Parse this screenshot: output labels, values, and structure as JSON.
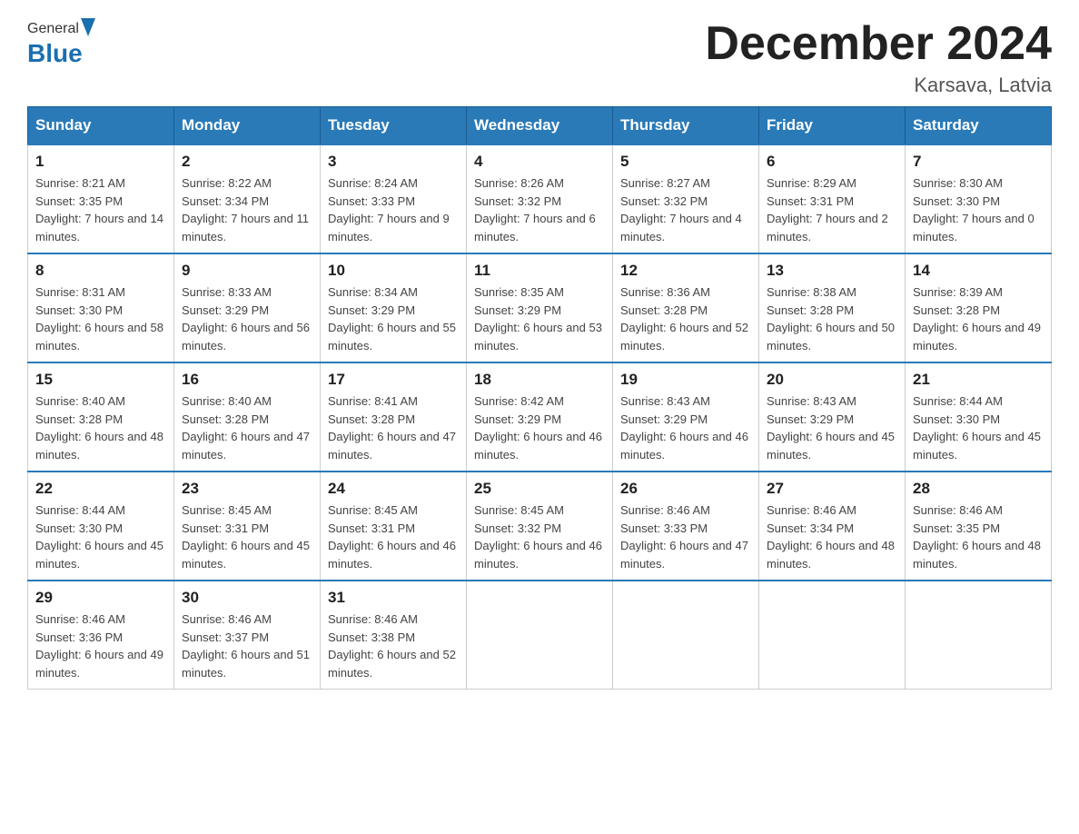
{
  "header": {
    "logo_general": "General",
    "logo_blue": "Blue",
    "month_title": "December 2024",
    "location": "Karsava, Latvia"
  },
  "weekdays": [
    "Sunday",
    "Monday",
    "Tuesday",
    "Wednesday",
    "Thursday",
    "Friday",
    "Saturday"
  ],
  "weeks": [
    [
      {
        "day": "1",
        "sunrise": "8:21 AM",
        "sunset": "3:35 PM",
        "daylight": "7 hours and 14 minutes."
      },
      {
        "day": "2",
        "sunrise": "8:22 AM",
        "sunset": "3:34 PM",
        "daylight": "7 hours and 11 minutes."
      },
      {
        "day": "3",
        "sunrise": "8:24 AM",
        "sunset": "3:33 PM",
        "daylight": "7 hours and 9 minutes."
      },
      {
        "day": "4",
        "sunrise": "8:26 AM",
        "sunset": "3:32 PM",
        "daylight": "7 hours and 6 minutes."
      },
      {
        "day": "5",
        "sunrise": "8:27 AM",
        "sunset": "3:32 PM",
        "daylight": "7 hours and 4 minutes."
      },
      {
        "day": "6",
        "sunrise": "8:29 AM",
        "sunset": "3:31 PM",
        "daylight": "7 hours and 2 minutes."
      },
      {
        "day": "7",
        "sunrise": "8:30 AM",
        "sunset": "3:30 PM",
        "daylight": "7 hours and 0 minutes."
      }
    ],
    [
      {
        "day": "8",
        "sunrise": "8:31 AM",
        "sunset": "3:30 PM",
        "daylight": "6 hours and 58 minutes."
      },
      {
        "day": "9",
        "sunrise": "8:33 AM",
        "sunset": "3:29 PM",
        "daylight": "6 hours and 56 minutes."
      },
      {
        "day": "10",
        "sunrise": "8:34 AM",
        "sunset": "3:29 PM",
        "daylight": "6 hours and 55 minutes."
      },
      {
        "day": "11",
        "sunrise": "8:35 AM",
        "sunset": "3:29 PM",
        "daylight": "6 hours and 53 minutes."
      },
      {
        "day": "12",
        "sunrise": "8:36 AM",
        "sunset": "3:28 PM",
        "daylight": "6 hours and 52 minutes."
      },
      {
        "day": "13",
        "sunrise": "8:38 AM",
        "sunset": "3:28 PM",
        "daylight": "6 hours and 50 minutes."
      },
      {
        "day": "14",
        "sunrise": "8:39 AM",
        "sunset": "3:28 PM",
        "daylight": "6 hours and 49 minutes."
      }
    ],
    [
      {
        "day": "15",
        "sunrise": "8:40 AM",
        "sunset": "3:28 PM",
        "daylight": "6 hours and 48 minutes."
      },
      {
        "day": "16",
        "sunrise": "8:40 AM",
        "sunset": "3:28 PM",
        "daylight": "6 hours and 47 minutes."
      },
      {
        "day": "17",
        "sunrise": "8:41 AM",
        "sunset": "3:28 PM",
        "daylight": "6 hours and 47 minutes."
      },
      {
        "day": "18",
        "sunrise": "8:42 AM",
        "sunset": "3:29 PM",
        "daylight": "6 hours and 46 minutes."
      },
      {
        "day": "19",
        "sunrise": "8:43 AM",
        "sunset": "3:29 PM",
        "daylight": "6 hours and 46 minutes."
      },
      {
        "day": "20",
        "sunrise": "8:43 AM",
        "sunset": "3:29 PM",
        "daylight": "6 hours and 45 minutes."
      },
      {
        "day": "21",
        "sunrise": "8:44 AM",
        "sunset": "3:30 PM",
        "daylight": "6 hours and 45 minutes."
      }
    ],
    [
      {
        "day": "22",
        "sunrise": "8:44 AM",
        "sunset": "3:30 PM",
        "daylight": "6 hours and 45 minutes."
      },
      {
        "day": "23",
        "sunrise": "8:45 AM",
        "sunset": "3:31 PM",
        "daylight": "6 hours and 45 minutes."
      },
      {
        "day": "24",
        "sunrise": "8:45 AM",
        "sunset": "3:31 PM",
        "daylight": "6 hours and 46 minutes."
      },
      {
        "day": "25",
        "sunrise": "8:45 AM",
        "sunset": "3:32 PM",
        "daylight": "6 hours and 46 minutes."
      },
      {
        "day": "26",
        "sunrise": "8:46 AM",
        "sunset": "3:33 PM",
        "daylight": "6 hours and 47 minutes."
      },
      {
        "day": "27",
        "sunrise": "8:46 AM",
        "sunset": "3:34 PM",
        "daylight": "6 hours and 48 minutes."
      },
      {
        "day": "28",
        "sunrise": "8:46 AM",
        "sunset": "3:35 PM",
        "daylight": "6 hours and 48 minutes."
      }
    ],
    [
      {
        "day": "29",
        "sunrise": "8:46 AM",
        "sunset": "3:36 PM",
        "daylight": "6 hours and 49 minutes."
      },
      {
        "day": "30",
        "sunrise": "8:46 AM",
        "sunset": "3:37 PM",
        "daylight": "6 hours and 51 minutes."
      },
      {
        "day": "31",
        "sunrise": "8:46 AM",
        "sunset": "3:38 PM",
        "daylight": "6 hours and 52 minutes."
      },
      null,
      null,
      null,
      null
    ]
  ]
}
